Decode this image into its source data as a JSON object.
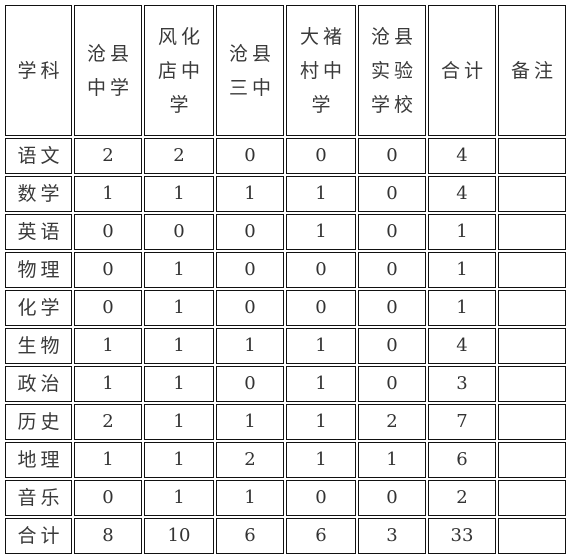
{
  "table": {
    "headers": [
      {
        "lines": [
          "学科"
        ]
      },
      {
        "lines": [
          "沧县",
          "中学"
        ]
      },
      {
        "lines": [
          "风化",
          "店中",
          "学"
        ]
      },
      {
        "lines": [
          "沧县",
          "三中"
        ]
      },
      {
        "lines": [
          "大褚",
          "村中",
          "学"
        ]
      },
      {
        "lines": [
          "沧县",
          "实验",
          "学校"
        ]
      },
      {
        "lines": [
          "合计"
        ]
      },
      {
        "lines": [
          "备注"
        ]
      }
    ],
    "rows": [
      {
        "subject": "语文",
        "values": [
          "2",
          "2",
          "0",
          "0",
          "0",
          "4",
          ""
        ]
      },
      {
        "subject": "数学",
        "values": [
          "1",
          "1",
          "1",
          "1",
          "0",
          "4",
          ""
        ]
      },
      {
        "subject": "英语",
        "values": [
          "0",
          "0",
          "0",
          "1",
          "0",
          "1",
          ""
        ]
      },
      {
        "subject": "物理",
        "values": [
          "0",
          "1",
          "0",
          "0",
          "0",
          "1",
          ""
        ]
      },
      {
        "subject": "化学",
        "values": [
          "0",
          "1",
          "0",
          "0",
          "0",
          "1",
          ""
        ]
      },
      {
        "subject": "生物",
        "values": [
          "1",
          "1",
          "1",
          "1",
          "0",
          "4",
          ""
        ]
      },
      {
        "subject": "政治",
        "values": [
          "1",
          "1",
          "0",
          "1",
          "0",
          "3",
          ""
        ]
      },
      {
        "subject": "历史",
        "values": [
          "2",
          "1",
          "1",
          "1",
          "2",
          "7",
          ""
        ]
      },
      {
        "subject": "地理",
        "values": [
          "1",
          "1",
          "2",
          "1",
          "1",
          "6",
          ""
        ]
      },
      {
        "subject": "音乐",
        "values": [
          "0",
          "1",
          "1",
          "0",
          "0",
          "2",
          ""
        ]
      },
      {
        "subject": "合计",
        "values": [
          "8",
          "10",
          "6",
          "6",
          "3",
          "33",
          ""
        ]
      }
    ]
  },
  "colors": {
    "border": "#111111",
    "text": "#3a3a3a",
    "background": "#ffffff"
  }
}
